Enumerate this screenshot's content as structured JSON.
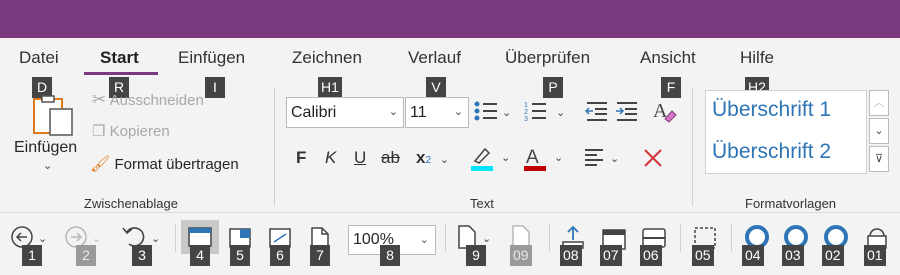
{
  "tabs": [
    {
      "label": "Datei",
      "keytip": "D"
    },
    {
      "label": "Start",
      "keytip": "R",
      "active": true
    },
    {
      "label": "Einfügen",
      "keytip": "I"
    },
    {
      "label": "Zeichnen",
      "keytip": "H1"
    },
    {
      "label": "Verlauf",
      "keytip": "V"
    },
    {
      "label": "Überprüfen",
      "keytip": "P"
    },
    {
      "label": "Ansicht",
      "keytip": "F"
    },
    {
      "label": "Hilfe",
      "keytip": "H2"
    }
  ],
  "clipboard": {
    "paste_label": "Einfügen",
    "cut_label": "Ausschneiden",
    "copy_label": "Kopieren",
    "format_painter_label": "Format übertragen",
    "group_label": "Zwischenablage"
  },
  "text_group": {
    "font_name": "Calibri",
    "font_size": "11",
    "bold": "F",
    "italic": "K",
    "underline": "U",
    "strike": "ab",
    "subscript": "x",
    "group_label": "Text"
  },
  "styles": {
    "heading1": "Überschrift 1",
    "heading2": "Überschrift 2",
    "group_label": "Formatvorlagen"
  },
  "qat": {
    "zoom": "100%",
    "keytips": [
      "1",
      "2",
      "3",
      "4",
      "5",
      "6",
      "7",
      "8",
      "9",
      "09",
      "08",
      "07",
      "06",
      "05",
      "04",
      "03",
      "02",
      "01"
    ]
  },
  "colors": {
    "accent": "#7a3a7d",
    "heading_blue": "#2e75b6",
    "highlight": "#00e5ff",
    "font_color": "#c00000"
  }
}
